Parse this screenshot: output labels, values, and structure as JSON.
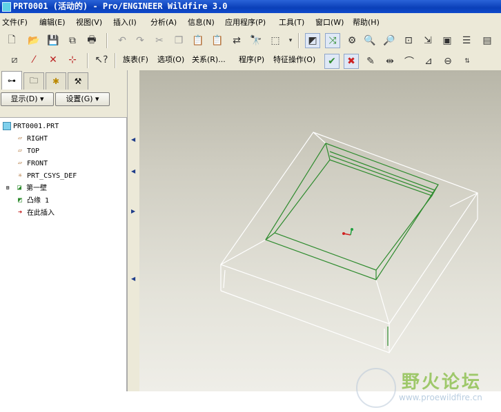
{
  "window": {
    "title": "PRT0001 (活动的) - Pro/ENGINEER Wildfire 3.0"
  },
  "menubar": {
    "items": [
      "文件(F)",
      "编辑(E)",
      "视图(V)",
      "插入(I)",
      "分析(A)",
      "信息(N)",
      "应用程序(P)",
      "工具(T)",
      "窗口(W)",
      "帮助(H)"
    ]
  },
  "feature_toolbar": {
    "items": [
      "族表(F)",
      "选项(O)",
      "关系(R)...",
      "程序(P)",
      "特征操作(O)"
    ]
  },
  "left_panel": {
    "display_button": "显示(D) ▾",
    "settings_button": "设置(G) ▾"
  },
  "model_tree": {
    "root": "PRT0001.PRT",
    "nodes": [
      {
        "label": "RIGHT",
        "icon": "datum-plane-icon"
      },
      {
        "label": "TOP",
        "icon": "datum-plane-icon"
      },
      {
        "label": "FRONT",
        "icon": "datum-plane-icon"
      },
      {
        "label": "PRT_CSYS_DEF",
        "icon": "csys-icon"
      },
      {
        "label": "第一壁",
        "icon": "sheetmetal-wall-icon"
      },
      {
        "label": "凸缘 1",
        "icon": "flange-icon"
      },
      {
        "label": "在此插入",
        "icon": "insert-here-arrow-icon"
      }
    ]
  },
  "watermark": {
    "title": "野火论坛",
    "url": "www.proewildfire.cn"
  },
  "colors": {
    "titlebar": "#0a3fb8",
    "model_edge_green": "#2e8b2e",
    "viewport_bg": "#d6d4c9"
  }
}
